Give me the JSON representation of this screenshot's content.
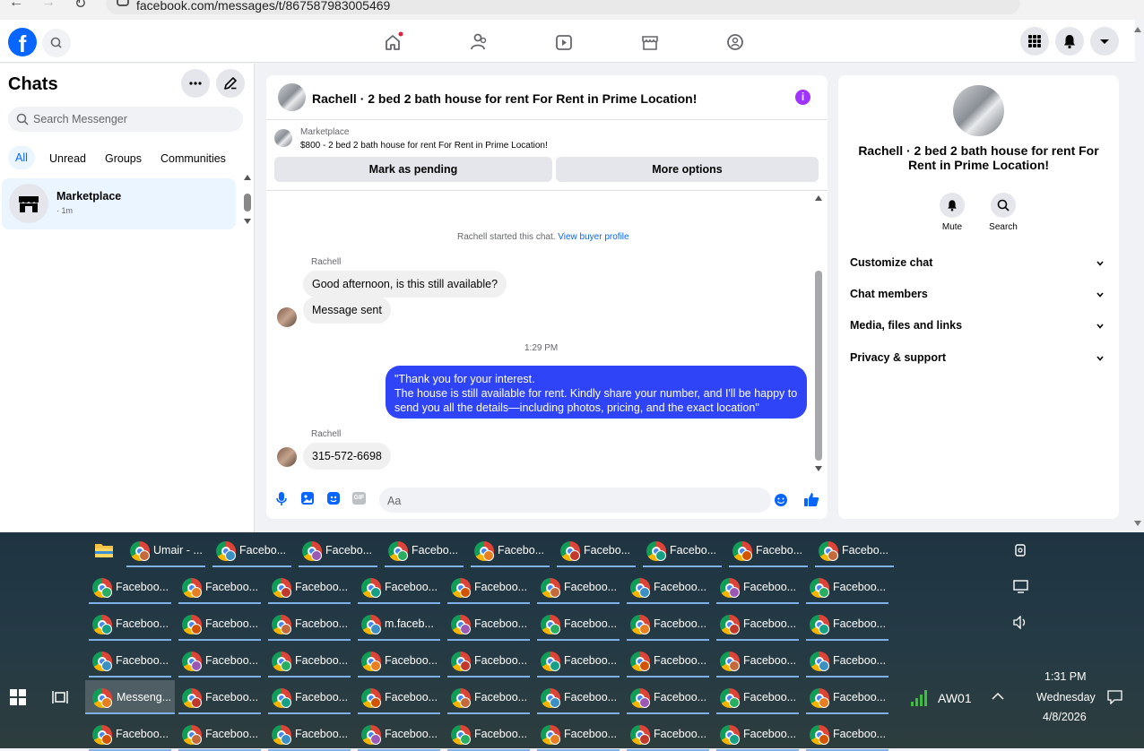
{
  "browser": {
    "url": "facebook.com/messages/t/867587983005469"
  },
  "fb": {
    "logo": "f"
  },
  "sidebar": {
    "title": "Chats",
    "search_placeholder": "Search Messenger",
    "filters": [
      "All",
      "Unread",
      "Groups",
      "Communities"
    ],
    "chat": {
      "name": "Marketplace",
      "time": "· 1m"
    }
  },
  "conversation": {
    "title": "Rachell · 2 bed 2 bath house for rent For Rent in Prime Location!",
    "marketplace_label": "Marketplace",
    "listing": "$800 - 2 bed 2 bath house for rent For Rent in Prime Location!",
    "mark_pending": "Mark as pending",
    "more_options": "More options",
    "started_text": "Rachell started this chat.",
    "view_profile": "View buyer profile",
    "sender1": "Rachell",
    "msg1": "Good afternoon, is this still available?",
    "msg2": "Message sent",
    "timestamp": "1:29 PM",
    "out_line1": "\"Thank you for your interest.",
    "out_line2": "The house is still available for rent. Kindly share your number, and I'll be happy to",
    "out_line3": "send you all the details—including photos, pricing, and the exact location\"",
    "sender2": "Rachell",
    "msg3": "315-572-6698",
    "composer_placeholder": "Aa",
    "gif": "GIF"
  },
  "details": {
    "title": "Rachell · 2 bed 2 bath house for rent For Rent in Prime Location!",
    "mute": "Mute",
    "search": "Search",
    "sections": [
      "Customize chat",
      "Chat members",
      "Media, files and links",
      "Privacy & support"
    ]
  },
  "taskbar": {
    "rows": [
      [
        "Umair - ...",
        "Facebo...",
        "Facebo...",
        "Facebo...",
        "Facebo...",
        "Facebo...",
        "Facebo...",
        "Facebo...",
        "Facebo..."
      ],
      [
        "Faceboo...",
        "Faceboo...",
        "Faceboo...",
        "Faceboo...",
        "Faceboo...",
        "Faceboo...",
        "Faceboo...",
        "Faceboo...",
        "Faceboo..."
      ],
      [
        "Faceboo...",
        "Faceboo...",
        "Faceboo...",
        "m.faceb...",
        "Faceboo...",
        "Faceboo...",
        "Faceboo...",
        "Faceboo...",
        "Faceboo..."
      ],
      [
        "Faceboo...",
        "Faceboo...",
        "Faceboo...",
        "Faceboo...",
        "Faceboo...",
        "Faceboo...",
        "Faceboo...",
        "Faceboo...",
        "Faceboo..."
      ],
      [
        "Messeng...",
        "Faceboo...",
        "Faceboo...",
        "Faceboo...",
        "Faceboo...",
        "Faceboo...",
        "Faceboo...",
        "Faceboo...",
        "Faceboo..."
      ],
      [
        "Faceboo...",
        "Faceboo...",
        "Faceboo...",
        "Faceboo...",
        "Faceboo...",
        "Faceboo...",
        "Faceboo...",
        "Faceboo...",
        "Faceboo..."
      ]
    ],
    "network_label": "AW01",
    "time": "1:31 PM",
    "day": "Wednesday",
    "date": "4/8/2026"
  },
  "colors": {
    "fb_blue": "#0866ff",
    "outgoing_bubble": "#3044f7",
    "info_purple": "#a033ff"
  }
}
